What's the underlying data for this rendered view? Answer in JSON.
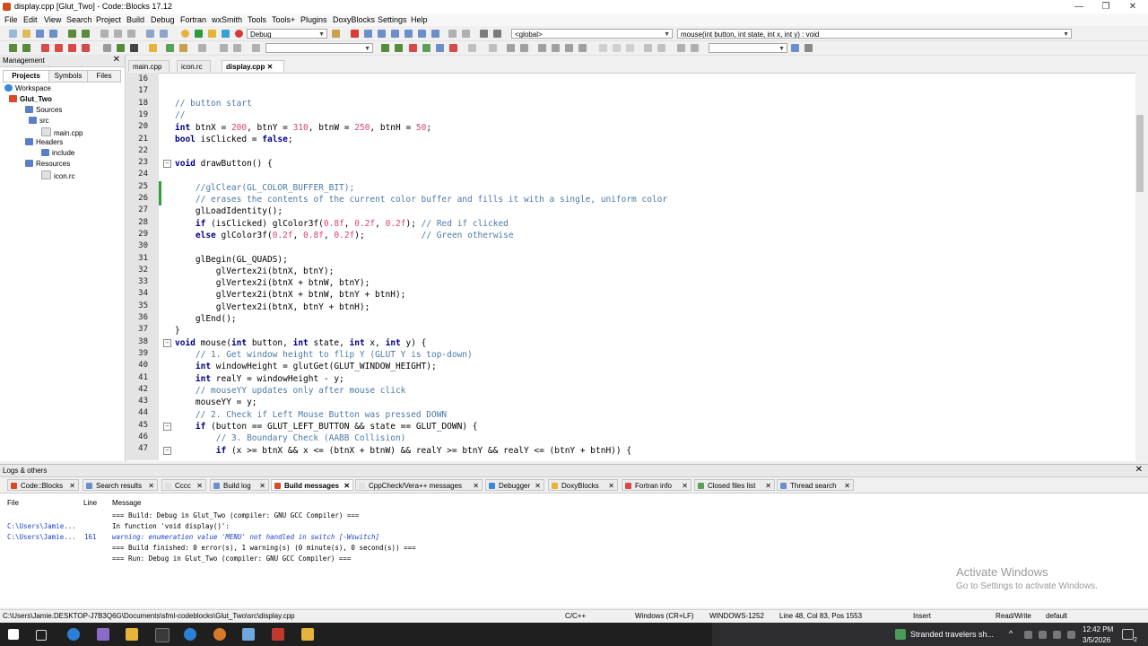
{
  "window": {
    "title": "display.cpp [Glut_Two] - Code::Blocks 17.12",
    "minimize": "—",
    "maximize": "❐",
    "close": "✕"
  },
  "menu": [
    "File",
    "Edit",
    "View",
    "Search",
    "Project",
    "Build",
    "Debug",
    "Fortran",
    "wxSmith",
    "Tools",
    "Tools+",
    "Plugins",
    "DoxyBlocks",
    "Settings",
    "Help"
  ],
  "toolbar": {
    "build_target": "Debug",
    "scope": "<global>",
    "function": "mouse(int button, int state, int x, int y) : void"
  },
  "management": {
    "title": "Management",
    "close": "✕",
    "tabs": [
      "Projects",
      "Symbols",
      "Files"
    ],
    "tree": {
      "workspace": "Workspace",
      "project": "Glut_Two",
      "sources": "Sources",
      "src": "src",
      "main_cpp": "main.cpp",
      "headers": "Headers",
      "include": "include",
      "resources": "Resources",
      "icon_rc": "icon.rc"
    }
  },
  "editor": {
    "tabs": [
      "main.cpp",
      "icon.rc",
      "display.cpp"
    ],
    "tab_close": "✕",
    "line_numbers": [
      "16",
      "17",
      "18",
      "19",
      "20",
      "21",
      "22",
      "23",
      "24",
      "25",
      "26",
      "27",
      "28",
      "29",
      "30",
      "31",
      "32",
      "33",
      "34",
      "35",
      "36",
      "37",
      "38",
      "39",
      "40",
      "41",
      "42",
      "43",
      "44",
      "45",
      "46",
      "47"
    ]
  },
  "logs": {
    "title": "Logs & others",
    "close": "✕",
    "tabs": [
      "Code::Blocks",
      "Search results",
      "Cccc",
      "Build log",
      "Build messages",
      "CppCheck/Vera++ messages",
      "Debugger",
      "DoxyBlocks",
      "Fortran info",
      "Closed files list",
      "Thread search"
    ],
    "columns": {
      "file": "File",
      "line": "Line",
      "message": "Message"
    },
    "rows": [
      {
        "file": "",
        "line": "",
        "message": "=== Build: Debug in Glut_Two (compiler: GNU GCC Compiler) ==="
      },
      {
        "file": "C:\\Users\\Jamie...",
        "line": "",
        "message": "In function 'void display()':"
      },
      {
        "file": "C:\\Users\\Jamie...",
        "line": "161",
        "message": "warning: enumeration value 'MENU' not handled in switch [-Wswitch]"
      },
      {
        "file": "",
        "line": "",
        "message": "=== Build finished: 0 error(s), 1 warning(s) (0 minute(s), 0 second(s)) ==="
      },
      {
        "file": "",
        "line": "",
        "message": "=== Run: Debug in Glut_Two (compiler: GNU GCC Compiler) ==="
      }
    ],
    "watermark_title": "Activate Windows",
    "watermark_sub": "Go to Settings to activate Windows."
  },
  "status": {
    "path": "C:\\Users\\Jamie.DESKTOP-J7B3Q6G\\Documents\\sfml-codeblocks\\Glut_Two\\src\\display.cpp",
    "language": "C/C++",
    "eol": "Windows (CR+LF)",
    "encoding": "WINDOWS-1252",
    "position": "Line 48, Col 83, Pos 1553",
    "mode": "Insert",
    "access": "Read/Write",
    "profile": "default"
  },
  "taskbar": {
    "weather": "Stranded travelers sh...",
    "time": "12:42 PM",
    "date": "3/5/2026",
    "notifications": "2"
  },
  "colors": {
    "keyword": "#00008b",
    "number": "#e0426b",
    "comment": "#4a7aa8",
    "changed_line": "#2ea043"
  }
}
